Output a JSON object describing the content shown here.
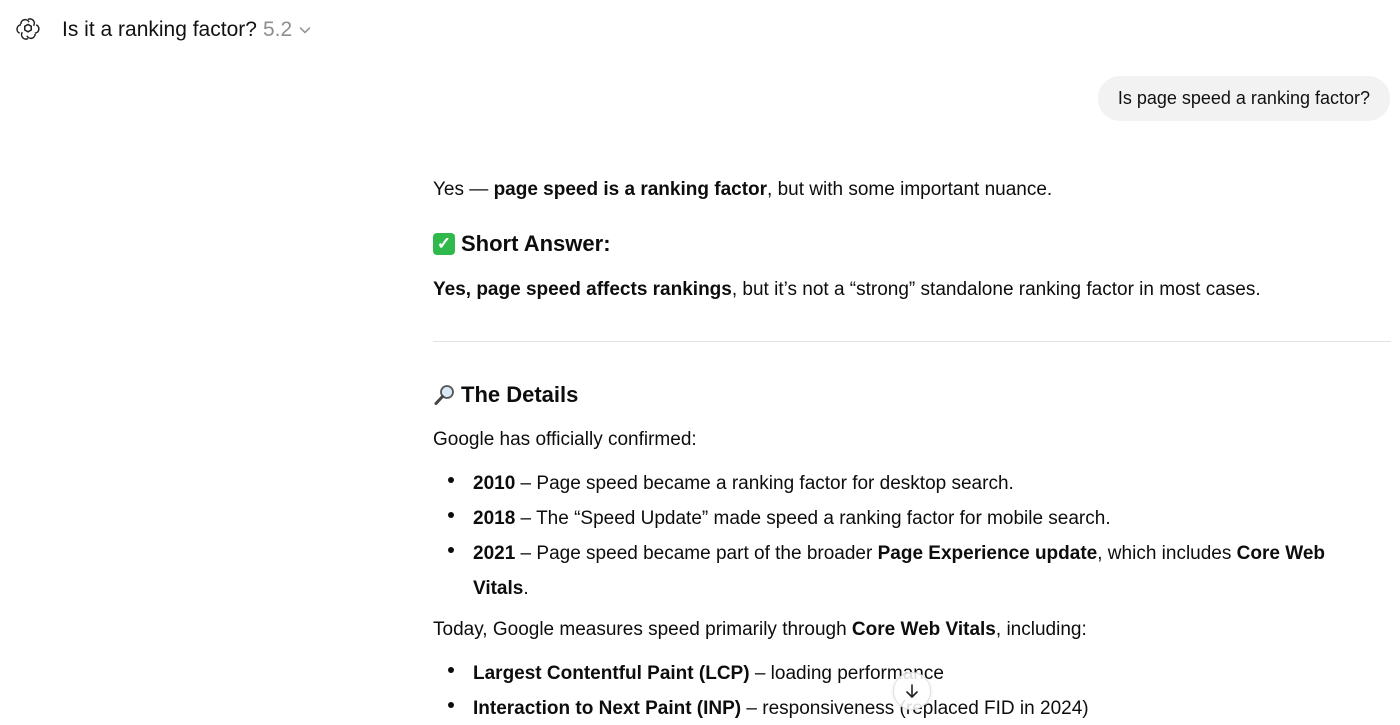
{
  "header": {
    "title": "Is it a ranking factor?",
    "version": "5.2",
    "logo_icon": "openai-logo-icon",
    "chevron_icon": "chevron-down-icon"
  },
  "user_message": "Is page speed a ranking factor?",
  "answer": {
    "intro": {
      "pre": "Yes — ",
      "bold": "page speed is a ranking factor",
      "post": ", but with some important nuance."
    },
    "short_answer": {
      "emoji": "✅",
      "heading": "Short Answer:",
      "bold": "Yes, page speed affects rankings",
      "post": ", but it’s not a “strong” standalone ranking factor in most cases."
    },
    "details": {
      "emoji_icon": "magnifying-glass-icon",
      "heading": "The Details",
      "intro": "Google has officially confirmed:",
      "timeline": [
        {
          "year": "2010",
          "text": " – Page speed became a ranking factor for desktop search."
        },
        {
          "year": "2018",
          "text": " – The “Speed Update” made speed a ranking factor for mobile search."
        },
        {
          "year": "2021",
          "pre": " – Page speed became part of the broader ",
          "bold1": "Page Experience update",
          "mid": ", which includes ",
          "bold2": "Core Web",
          "bold2b": "Vitals",
          "post": "."
        }
      ],
      "today": {
        "pre": "Today, Google measures speed primarily through ",
        "bold": "Core Web Vitals",
        "post": ", including:"
      },
      "vitals": [
        {
          "bold": "Largest Contentful Paint (LCP)",
          "text": " – loading performance"
        },
        {
          "bold": "Interaction to Next Paint (INP)",
          "text": " – responsiveness (replaced FID in 2024)"
        }
      ]
    }
  },
  "scroll_button_icon": "arrow-down-icon"
}
